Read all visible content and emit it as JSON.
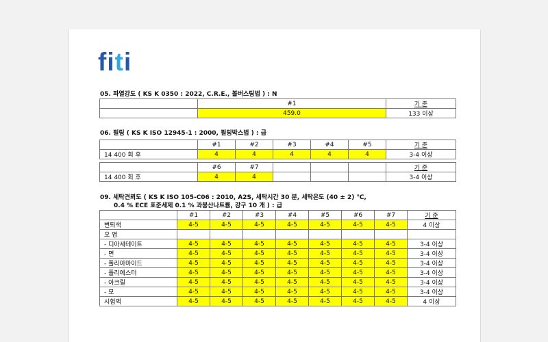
{
  "logo": {
    "text": "fiti"
  },
  "s05": {
    "title": "05.  파열강도 ( KS K 0350 : 2022, C.R.E., 볼버스팅법 ) : N",
    "col": "#1",
    "std_h": "기 준",
    "value": "459.0",
    "std": "133 이상"
  },
  "s06": {
    "title": "06.  필링 ( KS K ISO 12945-1 : 2000, 필링박스법 ) : 급",
    "std_h": "기 준",
    "row_label": "14 400 회 후",
    "cols_a": [
      "#1",
      "#2",
      "#3",
      "#4",
      "#5"
    ],
    "vals_a": [
      "4",
      "4",
      "4",
      "4",
      "4"
    ],
    "std_a": "3-4 이상",
    "cols_b": [
      "#6",
      "#7"
    ],
    "vals_b": [
      "4",
      "4"
    ],
    "std_b": "3-4 이상"
  },
  "s09": {
    "title1": "09.  세탁견뢰도 ( KS K ISO 105-C06 : 2010, A2S, 세탁시간 30 분, 세탁온도 (40 ± 2) ℃,",
    "title2": "0.4 % ECE 표준세제 0.1 % 과붕산나트륨, 강구 10 개 ) : 급",
    "cols": [
      "#1",
      "#2",
      "#3",
      "#4",
      "#5",
      "#6",
      "#7"
    ],
    "std_h": "기 준",
    "rows": [
      {
        "label": "변퇴색",
        "vals": [
          "4-5",
          "4-5",
          "4-5",
          "4-5",
          "4-5",
          "4-5",
          "4-5"
        ],
        "std": "4 이상"
      },
      {
        "label": "오   염",
        "vals": [
          "",
          "",
          "",
          "",
          "",
          "",
          ""
        ],
        "std": ""
      },
      {
        "label": "- 디아세테이트",
        "vals": [
          "4-5",
          "4-5",
          "4-5",
          "4-5",
          "4-5",
          "4-5",
          "4-5"
        ],
        "std": "3-4 이상"
      },
      {
        "label": "- 면",
        "vals": [
          "4-5",
          "4-5",
          "4-5",
          "4-5",
          "4-5",
          "4-5",
          "4-5"
        ],
        "std": "3-4 이상"
      },
      {
        "label": "- 폴리아마이드",
        "vals": [
          "4-5",
          "4-5",
          "4-5",
          "4-5",
          "4-5",
          "4-5",
          "4-5"
        ],
        "std": "3-4 이상"
      },
      {
        "label": "- 폴리에스터",
        "vals": [
          "4-5",
          "4-5",
          "4-5",
          "4-5",
          "4-5",
          "4-5",
          "4-5"
        ],
        "std": "3-4 이상"
      },
      {
        "label": "- 아크릴",
        "vals": [
          "4-5",
          "4-5",
          "4-5",
          "4-5",
          "4-5",
          "4-5",
          "4-5"
        ],
        "std": "3-4 이상"
      },
      {
        "label": "- 모",
        "vals": [
          "4-5",
          "4-5",
          "4-5",
          "4-5",
          "4-5",
          "4-5",
          "4-5"
        ],
        "std": "3-4 이상"
      },
      {
        "label": "시험액",
        "vals": [
          "4-5",
          "4-5",
          "4-5",
          "4-5",
          "4-5",
          "4-5",
          "4-5"
        ],
        "std": "4 이상"
      }
    ]
  }
}
